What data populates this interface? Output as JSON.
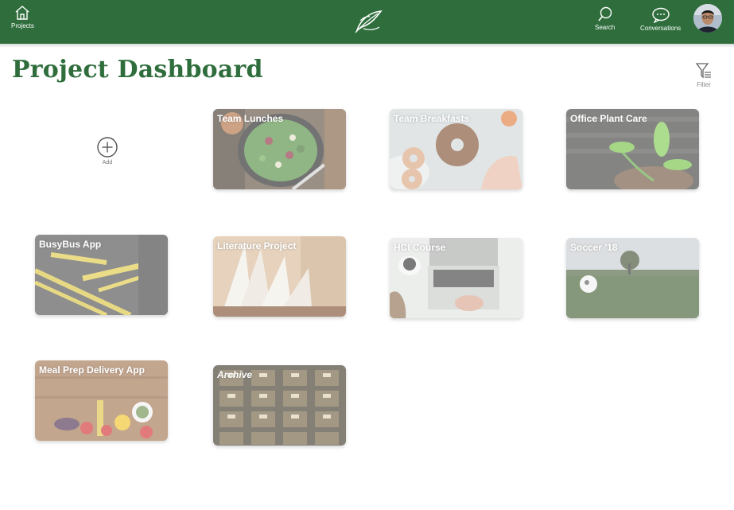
{
  "header": {
    "projects_label": "Projects",
    "search_label": "Search",
    "conversations_label": "Conversations"
  },
  "page": {
    "title": "Project Dashboard",
    "filter_label": "Filter",
    "add_label": "Add"
  },
  "projects": [
    {
      "title": "Team Lunches"
    },
    {
      "title": "Team Breakfasts"
    },
    {
      "title": "Office Plant Care"
    },
    {
      "title": "BusyBus App"
    },
    {
      "title": "Literature Project"
    },
    {
      "title": "HCI Course"
    },
    {
      "title": "Soccer '18"
    },
    {
      "title": "Meal Prep Delivery App"
    },
    {
      "title": "Archive"
    }
  ],
  "colors": {
    "header_green": "#2f6e3c",
    "title_green": "#2f6e3c"
  },
  "icons": [
    "home-icon",
    "leaf-logo",
    "search-icon",
    "chat-bubble-icon",
    "filter-icon",
    "plus-circle-icon"
  ]
}
